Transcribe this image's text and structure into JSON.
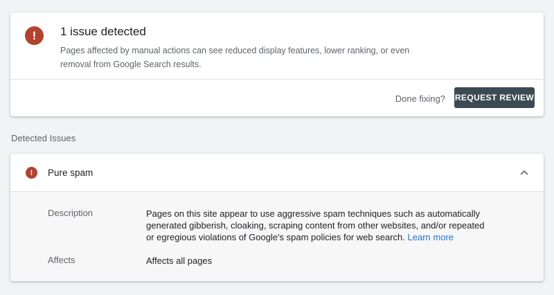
{
  "summary": {
    "icon": "error-icon",
    "icon_glyph": "!",
    "title": "1 issue detected",
    "body": "Pages affected by manual actions can see reduced display features, lower ranking, or even removal from Google Search results.",
    "done_fixing": "Done fixing?",
    "request_review": "REQUEST REVIEW"
  },
  "section_label": "Detected Issues",
  "issue": {
    "icon": "error-icon",
    "icon_glyph": "!",
    "title": "Pure spam",
    "expanded": true,
    "description_label": "Description",
    "description_text": "Pages on this site appear to use aggressive spam techniques such as automatically generated gibberish, cloaking, scraping content from other websites, and/or repeated or egregious violations of Google's spam policies for web search.",
    "learn_more": "Learn more",
    "affects_label": "Affects",
    "affects_value": "Affects all pages"
  },
  "colors": {
    "error": "#b3422f",
    "button_bg": "#3c4a52",
    "link": "#1a73e8",
    "page_bg": "#f1f3f4"
  }
}
